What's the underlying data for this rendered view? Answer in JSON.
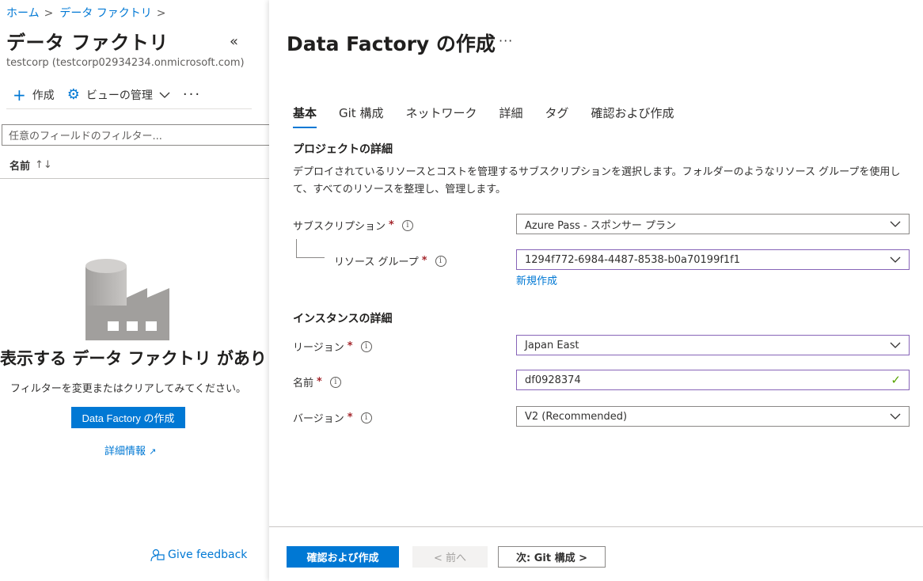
{
  "breadcrumb": {
    "home": "ホーム",
    "current": "データ ファクトリ",
    "sep": ">"
  },
  "left": {
    "title": "データ ファクトリ",
    "collapse_icon": "«",
    "subtitle": "testcorp (testcorp02934234.onmicrosoft.com)",
    "toolbar": {
      "create": "作成",
      "manage_view": "ビューの管理",
      "more": "···"
    },
    "filter_placeholder": "任意のフィールドのフィルター...",
    "column": {
      "name": "名前",
      "sort": "↑↓"
    },
    "empty": {
      "title": "表示する データ ファクトリ がありません",
      "text": "フィルターを変更またはクリアしてみてください。",
      "create_button": "Data Factory の作成",
      "learn_more": "詳細情報"
    },
    "feedback": "Give feedback"
  },
  "panel": {
    "title": "Data Factory の作成",
    "more": "···",
    "tabs": [
      "基本",
      "Git 構成",
      "ネットワーク",
      "詳細",
      "タグ",
      "確認および作成"
    ],
    "active_tab": "基本",
    "project_section": "プロジェクトの詳細",
    "project_desc": "デプロイされているリソースとコストを管理するサブスクリプションを選択します。フォルダーのようなリソース グループを使用して、すべてのリソースを整理し、管理します。",
    "subscription": {
      "label": "サブスクリプション",
      "value": "Azure Pass - スポンサー プラン"
    },
    "resource_group": {
      "label": "リソース グループ",
      "value": "1294f772-6984-4487-8538-b0a70199f1f1",
      "new_link": "新規作成"
    },
    "instance_section": "インスタンスの詳細",
    "region": {
      "label": "リージョン",
      "value": "Japan East"
    },
    "name": {
      "label": "名前",
      "value": "df0928374"
    },
    "version": {
      "label": "バージョン",
      "value": "V2 (Recommended)"
    },
    "required_mark": "*",
    "info_mark": "i"
  },
  "footer": {
    "review_create": "確認および作成",
    "prev": "< 前へ",
    "next": "次: Git 構成 >"
  },
  "colors": {
    "accent": "#0078d4",
    "required": "#a4262c",
    "focus_border": "#8764b8",
    "valid": "#57a300"
  }
}
